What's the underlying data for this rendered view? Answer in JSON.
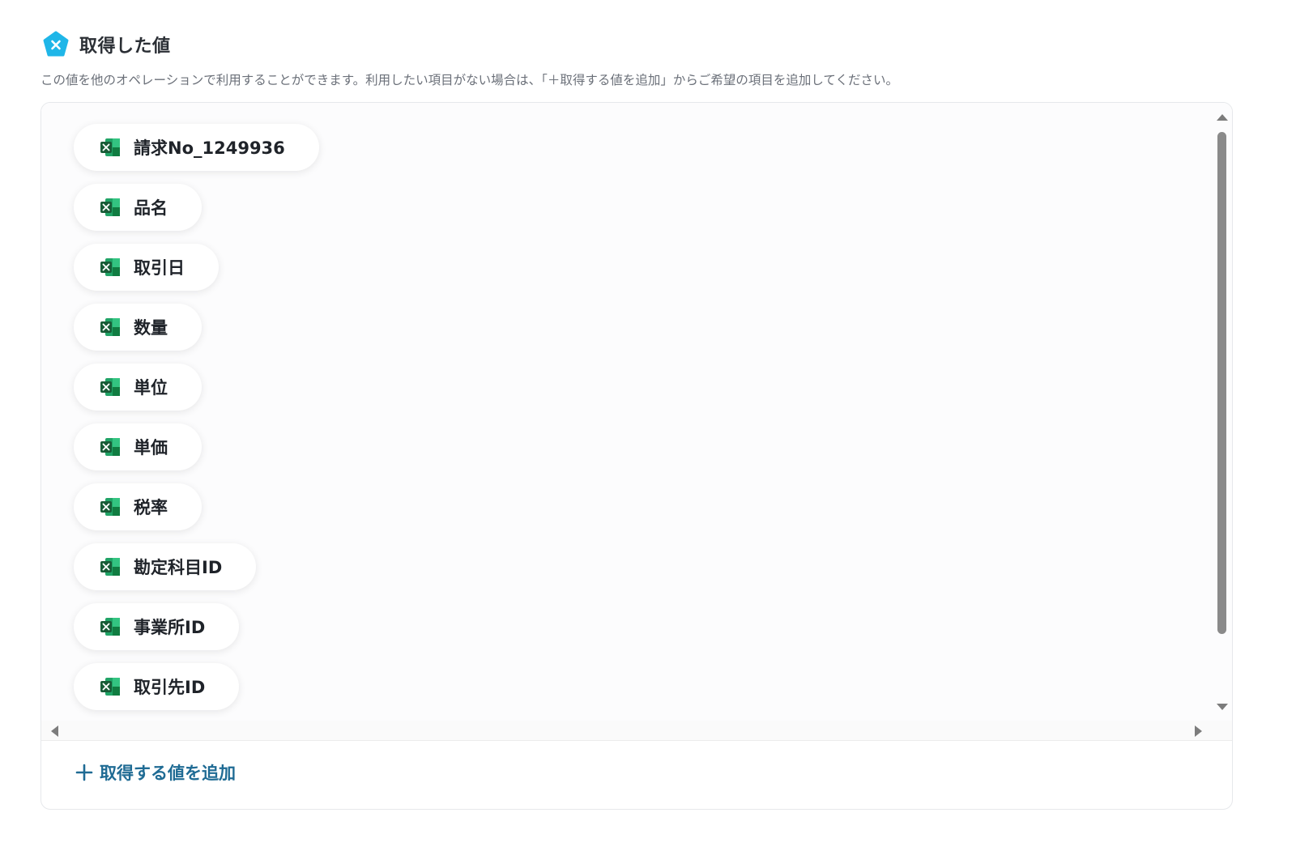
{
  "header": {
    "title": "取得した値",
    "description": "この値を他のオペレーションで利用することができます。利用したい項目がない場合は、「＋取得する値を追加」からご希望の項目を追加してください。",
    "badge_color": "#1fb6e8"
  },
  "values": {
    "items": [
      {
        "label": "請求No_1249936",
        "icon": "excel-icon"
      },
      {
        "label": "品名",
        "icon": "excel-icon"
      },
      {
        "label": "取引日",
        "icon": "excel-icon"
      },
      {
        "label": "数量",
        "icon": "excel-icon"
      },
      {
        "label": "単位",
        "icon": "excel-icon"
      },
      {
        "label": "単価",
        "icon": "excel-icon"
      },
      {
        "label": "税率",
        "icon": "excel-icon"
      },
      {
        "label": "勘定科目ID",
        "icon": "excel-icon"
      },
      {
        "label": "事業所ID",
        "icon": "excel-icon"
      },
      {
        "label": "取引先ID",
        "icon": "excel-icon"
      }
    ]
  },
  "actions": {
    "add_value_label": "取得する値を追加",
    "accent_color": "#1f6b94"
  }
}
